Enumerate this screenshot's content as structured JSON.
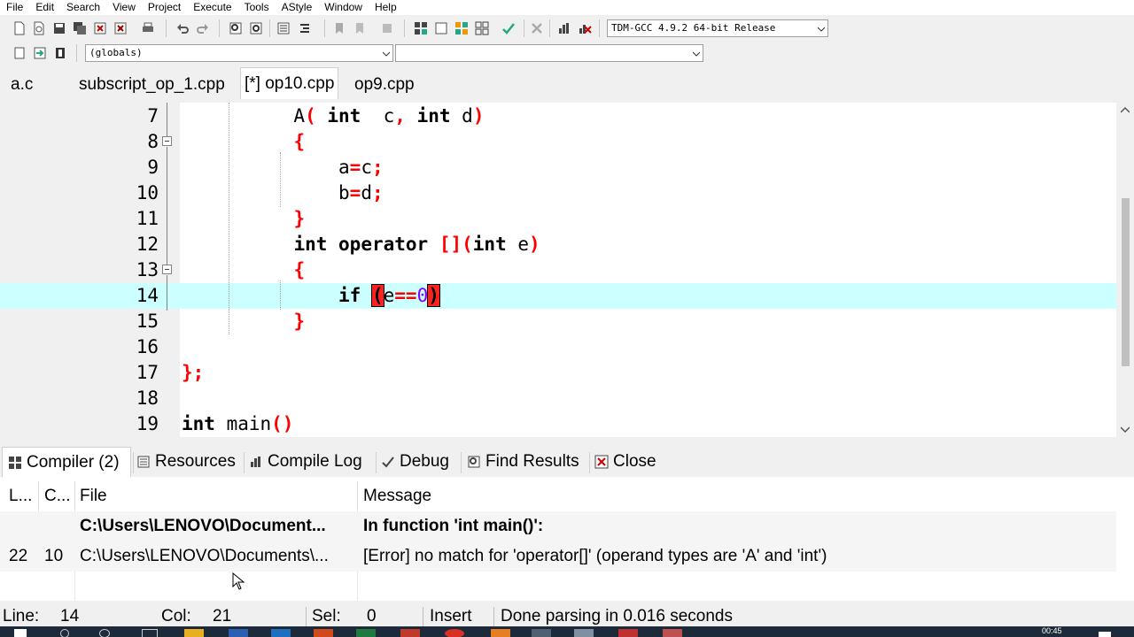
{
  "menu": [
    "File",
    "Edit",
    "Search",
    "View",
    "Project",
    "Execute",
    "Tools",
    "AStyle",
    "Window",
    "Help"
  ],
  "toolbar": {
    "compiler_select": "TDM-GCC 4.9.2 64-bit Release",
    "scope_select": "(globals)",
    "member_select": ""
  },
  "tabs": [
    "a.c",
    "subscript_op_1.cpp",
    "[*] op10.cpp",
    "op9.cpp"
  ],
  "active_tab": 2,
  "editor": {
    "lines": [
      {
        "n": "7"
      },
      {
        "n": "8"
      },
      {
        "n": "9"
      },
      {
        "n": "10"
      },
      {
        "n": "11"
      },
      {
        "n": "12"
      },
      {
        "n": "13"
      },
      {
        "n": "14"
      },
      {
        "n": "15"
      },
      {
        "n": "16"
      },
      {
        "n": "17"
      },
      {
        "n": "18"
      },
      {
        "n": "19"
      }
    ],
    "current_line": "14"
  },
  "panel_tabs": [
    {
      "label": "Compiler (2)",
      "icon": "grid-icon"
    },
    {
      "label": "Resources",
      "icon": "resources-icon"
    },
    {
      "label": "Compile Log",
      "icon": "chart-icon"
    },
    {
      "label": "Debug",
      "icon": "check-icon"
    },
    {
      "label": "Find Results",
      "icon": "find-icon"
    },
    {
      "label": "Close",
      "icon": "close-icon"
    }
  ],
  "messages": {
    "headers": {
      "line": "L...",
      "col": "C...",
      "file": "File",
      "message": "Message"
    },
    "rows": [
      {
        "line": "",
        "col": "",
        "file": "C:\\Users\\LENOVO\\Document...",
        "message": "In function 'int main()':",
        "bold": true
      },
      {
        "line": "22",
        "col": "10",
        "file": "C:\\Users\\LENOVO\\Documents\\...",
        "message": "[Error] no match for 'operator[]' (operand types are 'A' and 'int')",
        "bold": false
      }
    ]
  },
  "status": {
    "line_label": "Line:",
    "line_value": "14",
    "col_label": "Col:",
    "col_value": "21",
    "sel_label": "Sel:",
    "sel_value": "0",
    "mode": "Insert",
    "message": "Done parsing in 0.016 seconds"
  },
  "clock": "00:45",
  "colors": {
    "current_line": "#ccffff",
    "symbol": "#ff0000",
    "number": "#8000ff"
  }
}
